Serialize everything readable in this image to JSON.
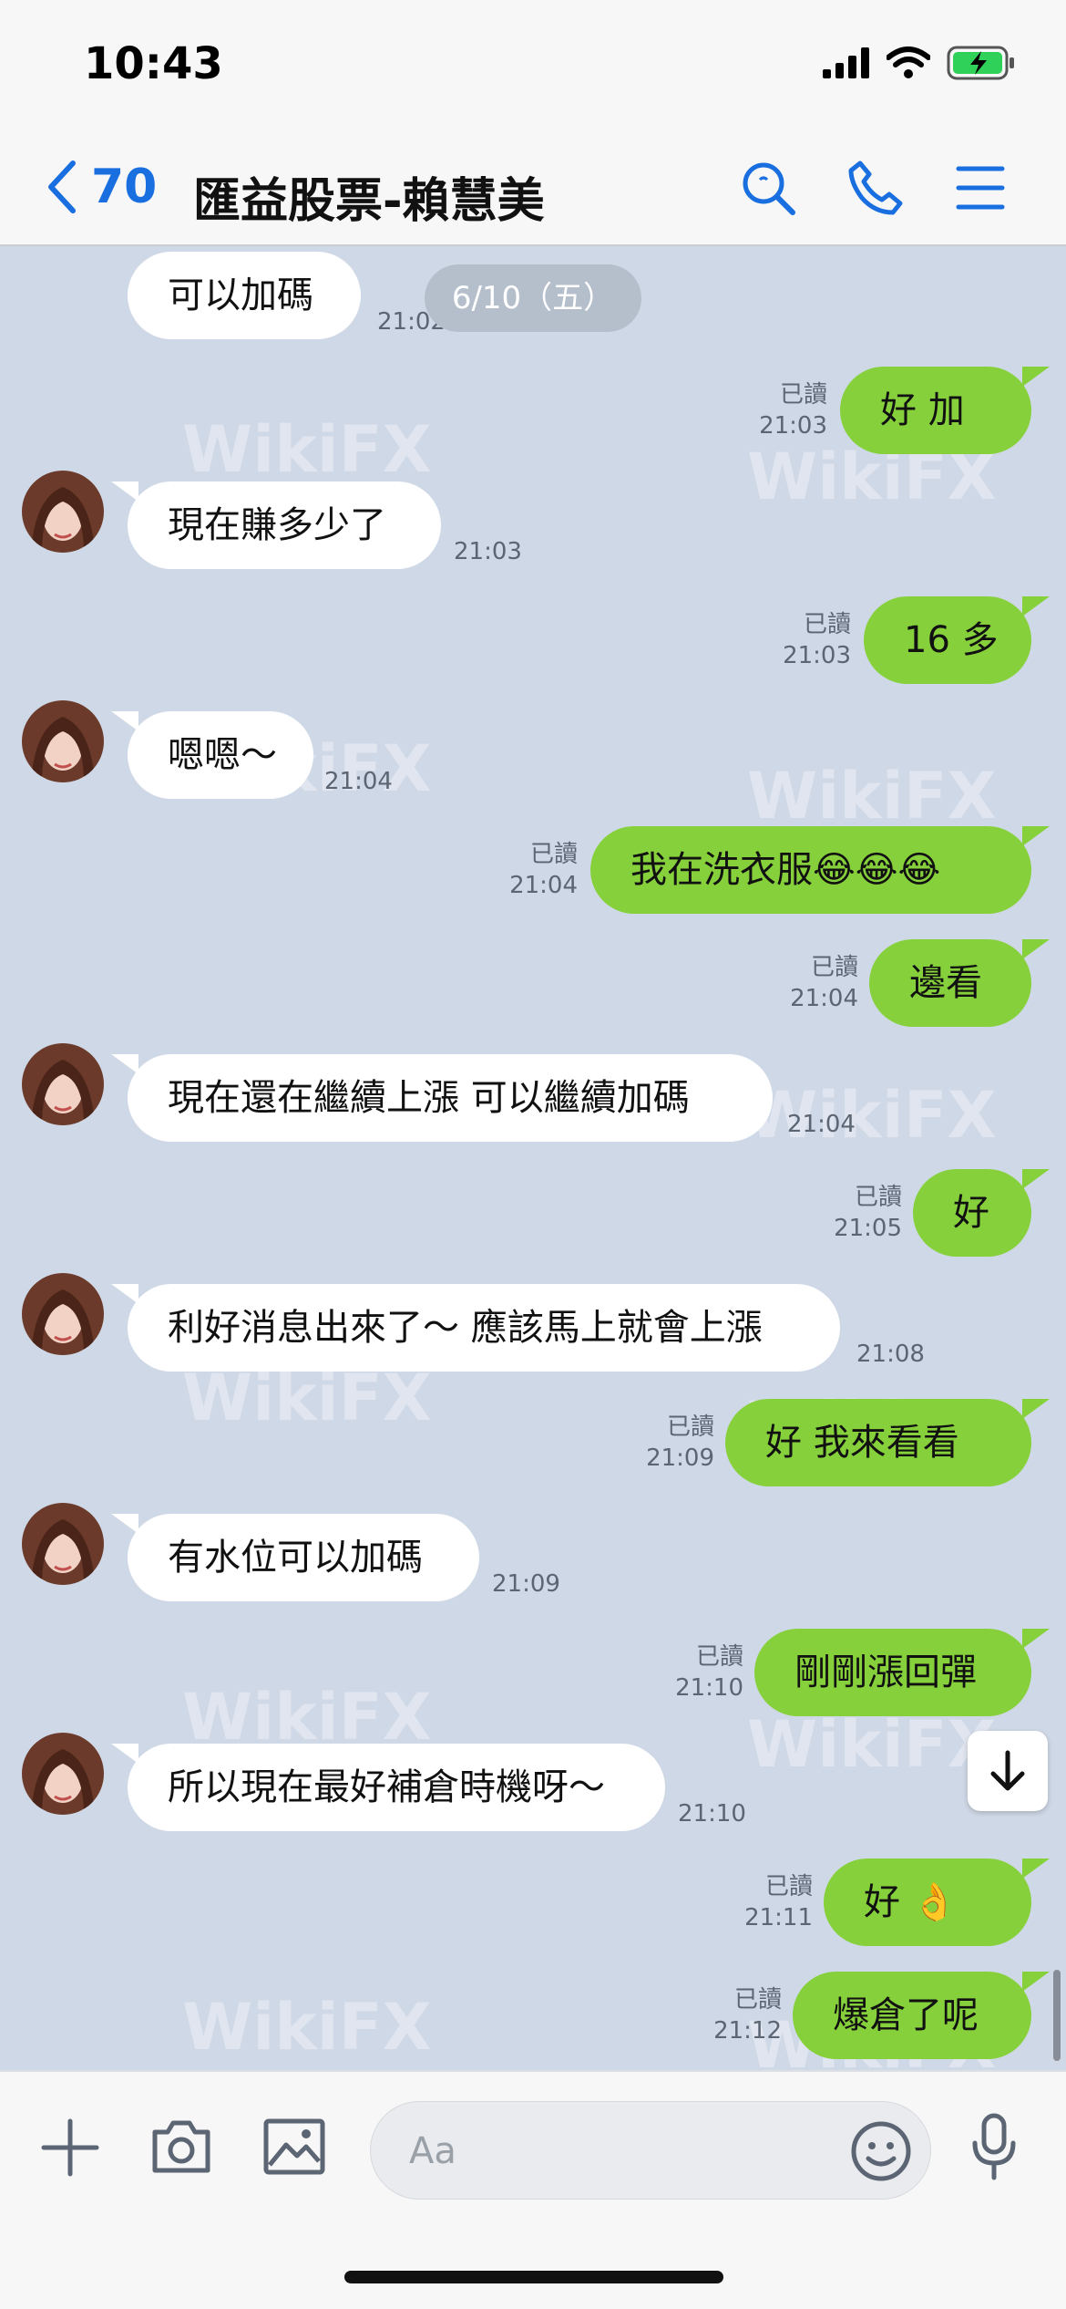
{
  "status_bar": {
    "time": "10:43"
  },
  "header": {
    "back_count": "70",
    "title": "匯益股票-賴慧美"
  },
  "date_pill": "6/10（五）",
  "read_label": "已讀",
  "watermark": "WikiFX",
  "messages": [
    {
      "text": "可以加碼",
      "time": "21:02"
    },
    {
      "text": "好 加",
      "time": "21:03"
    },
    {
      "text": "現在賺多少了",
      "time": "21:03"
    },
    {
      "text": "16 多",
      "time": "21:03"
    },
    {
      "text": "嗯嗯～",
      "time": "21:04"
    },
    {
      "text": "我在洗衣服😂😂😂",
      "time": "21:04"
    },
    {
      "text": "邊看",
      "time": "21:04"
    },
    {
      "text": "現在還在繼續上漲  可以繼續加碼",
      "time": "21:04"
    },
    {
      "text": "好",
      "time": "21:05"
    },
    {
      "text": "利好消息出來了～ 應該馬上就會上漲",
      "time": "21:08"
    },
    {
      "text": "好   我來看看",
      "time": "21:09"
    },
    {
      "text": "有水位可以加碼",
      "time": "21:09"
    },
    {
      "text": "剛剛漲回彈",
      "time": "21:10"
    },
    {
      "text": "所以現在最好補倉時機呀～",
      "time": "21:10"
    },
    {
      "text": "好   👌",
      "time": "21:11"
    },
    {
      "text": "爆倉了呢",
      "time": "21:12"
    }
  ],
  "input": {
    "placeholder": "Aa"
  },
  "colors": {
    "chat_bg": "#cfd8e6",
    "outgoing_bubble": "#86d13b",
    "incoming_bubble": "#ffffff",
    "accent": "#1a6fe0"
  }
}
